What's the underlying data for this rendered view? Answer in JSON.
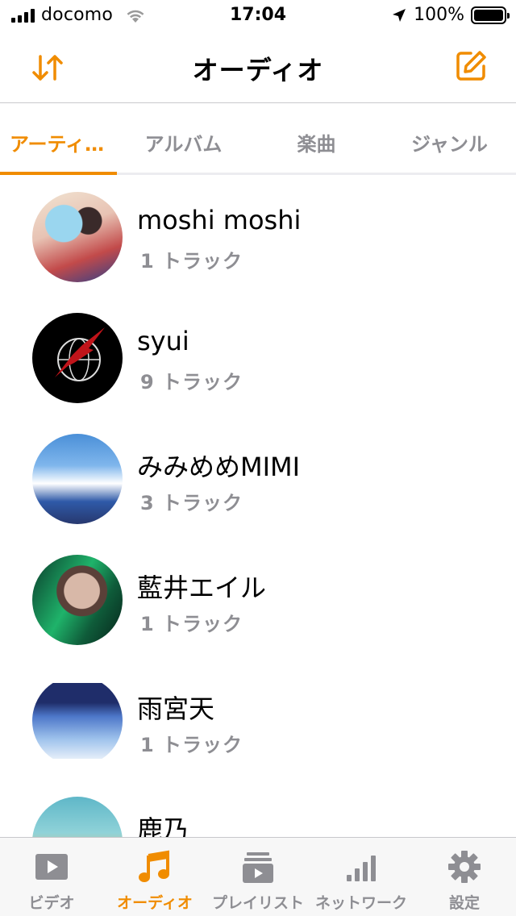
{
  "status_bar": {
    "carrier": "docomo",
    "time": "17:04",
    "battery": "100%"
  },
  "nav": {
    "title": "オーディオ"
  },
  "tabs": [
    {
      "label": "アーティ…",
      "active": true
    },
    {
      "label": "アルバム",
      "active": false
    },
    {
      "label": "楽曲",
      "active": false
    },
    {
      "label": "ジャンル",
      "active": false
    }
  ],
  "artists": [
    {
      "name": "moshi moshi",
      "count": "1 トラック"
    },
    {
      "name": "syui",
      "count": "9 トラック"
    },
    {
      "name": "みみめめMIMI",
      "count": "3 トラック"
    },
    {
      "name": "藍井エイル",
      "count": "1 トラック"
    },
    {
      "name": "雨宮天",
      "count": "1 トラック"
    },
    {
      "name": "鹿乃",
      "count": ""
    }
  ],
  "tab_bar": [
    {
      "label": "ビデオ",
      "icon": "video-icon",
      "active": false
    },
    {
      "label": "オーディオ",
      "icon": "music-note-icon",
      "active": true
    },
    {
      "label": "プレイリスト",
      "icon": "playlist-icon",
      "active": false
    },
    {
      "label": "ネットワーク",
      "icon": "network-bars-icon",
      "active": false
    },
    {
      "label": "設定",
      "icon": "gear-icon",
      "active": false
    }
  ],
  "colors": {
    "accent": "#f08c00",
    "inactive": "#8e8e93"
  }
}
